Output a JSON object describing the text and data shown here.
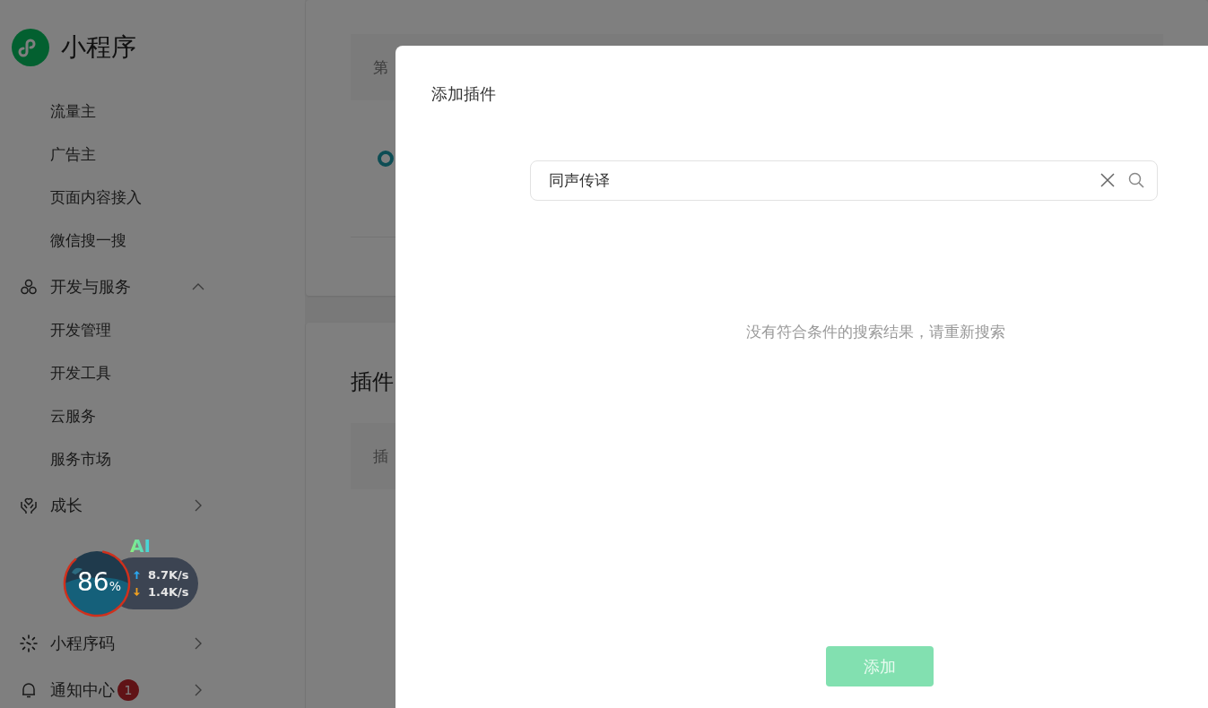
{
  "sidebar": {
    "title": "小程序",
    "items": [
      {
        "label": "流量主"
      },
      {
        "label": "广告主"
      },
      {
        "label": "页面内容接入"
      },
      {
        "label": "微信搜一搜"
      }
    ],
    "groups": [
      {
        "label": "开发与服务",
        "expanded": true,
        "children": [
          {
            "label": "开发管理"
          },
          {
            "label": "开发工具"
          },
          {
            "label": "云服务"
          },
          {
            "label": "服务市场"
          }
        ]
      },
      {
        "label": "成长",
        "expanded": false
      },
      {
        "label": "小程序码",
        "expanded": false
      },
      {
        "label": "通知中心",
        "expanded": false,
        "badge": "1"
      }
    ]
  },
  "background_page": {
    "card_text": "第",
    "section_title": "插件",
    "section_text": "插"
  },
  "dialog": {
    "title": "添加插件",
    "search": {
      "value": "同声传译"
    },
    "empty_message": "没有符合条件的搜索结果，请重新搜索",
    "button": {
      "label": "添加",
      "disabled": true
    }
  },
  "widget": {
    "tag": "AI",
    "percent": "86",
    "unit": "%",
    "upload": "8.7K/s",
    "download": "1.4K/s"
  }
}
